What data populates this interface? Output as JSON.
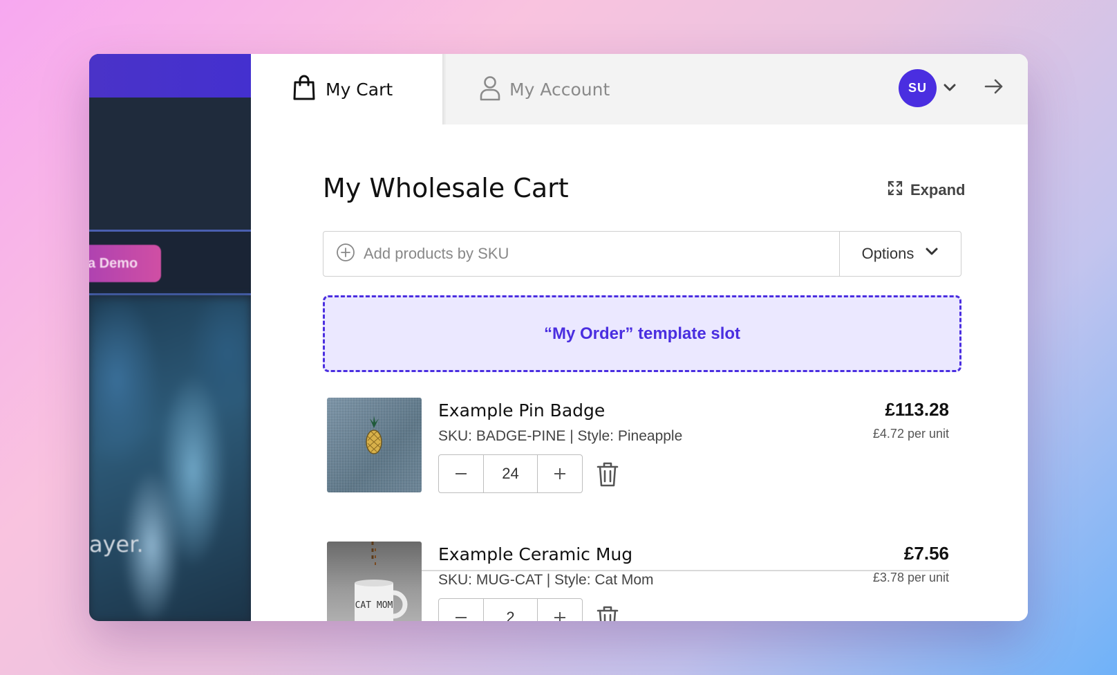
{
  "background_site": {
    "button_label": "a Demo",
    "text_fragment": "ayer."
  },
  "tabs": {
    "cart_label": "My Cart",
    "account_label": "My Account"
  },
  "user": {
    "initials": "SU"
  },
  "cart": {
    "title": "My Wholesale Cart",
    "expand_label": "Expand",
    "sku_placeholder": "Add products by SKU",
    "options_label": "Options",
    "template_slot_label": "“My Order” template slot",
    "items": [
      {
        "name": "Example Pin Badge",
        "sku_line": "SKU: BADGE-PINE | Style: Pineapple",
        "price": "£113.28",
        "unit_price": "£4.72 per unit",
        "quantity": "24"
      },
      {
        "name": "Example Ceramic Mug",
        "sku_line": "SKU: MUG-CAT | Style: Cat Mom",
        "price": "£7.56",
        "unit_price": "£3.78 per unit",
        "quantity": "2",
        "image_text": "CAT MOM"
      }
    ]
  },
  "colors": {
    "accent": "#4a2ee0",
    "slot_bg": "#ebe8ff"
  },
  "icons": {
    "cart_tab": "shopping-bag-icon",
    "account_tab": "user-icon",
    "expand": "expand-icon",
    "sku_add": "plus-circle-icon",
    "options": "chevron-down-icon",
    "remove": "trash-icon",
    "exit": "arrow-right-icon"
  }
}
